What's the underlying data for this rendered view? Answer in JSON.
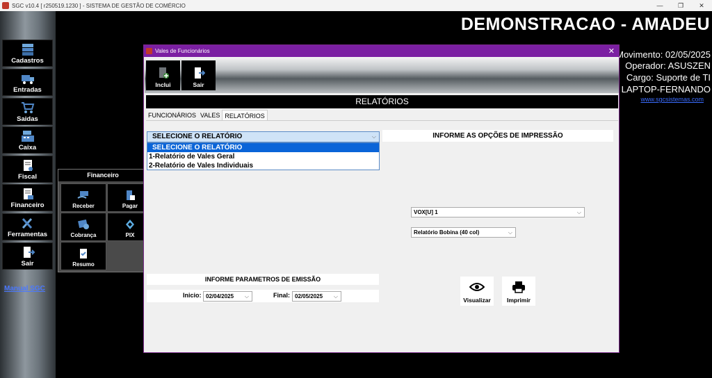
{
  "window": {
    "title": "SGC v10.4 [ r250519.1230 ] - SISTEMA DE GESTÃO DE COMÉRCIO",
    "controls": [
      "—",
      "❐",
      "✕"
    ]
  },
  "sidebar": {
    "items": [
      {
        "label": "Cadastros",
        "icon": "cabinet-icon"
      },
      {
        "label": "Entradas",
        "icon": "truck-icon"
      },
      {
        "label": "Saidas",
        "icon": "cart-icon"
      },
      {
        "label": "Caixa",
        "icon": "register-icon"
      },
      {
        "label": "Fiscal",
        "icon": "fiscal-doc-icon"
      },
      {
        "label": "Financeiro",
        "icon": "finance-doc-icon"
      },
      {
        "label": "Ferramentas",
        "icon": "tools-icon"
      },
      {
        "label": "Sair",
        "icon": "exit-door-icon"
      }
    ],
    "manual_link": "Manual SGC"
  },
  "header": {
    "company": "DEMONSTRACAO - AMADEU",
    "movimento": "Movimento: 02/05/2025",
    "operador": "Operador: ASUSZEN",
    "cargo": "Cargo: Suporte de TI",
    "machine": "LAPTOP-FERNANDO",
    "site": "www.sgcsistemas.com"
  },
  "financeiro_panel": {
    "title": "Financeiro",
    "buttons": [
      {
        "label": "Receber",
        "icon": "receive-money-icon"
      },
      {
        "label": "Pagar",
        "icon": "pay-icon"
      },
      {
        "label": "Cobrança",
        "icon": "billing-icon"
      },
      {
        "label": "PIX",
        "icon": "pix-icon"
      },
      {
        "label": "Resumo",
        "icon": "summary-icon"
      }
    ]
  },
  "modal": {
    "title": "Vales de Funcionários",
    "toolbar": {
      "incluir": "Inclui",
      "sair": "Sair"
    },
    "header": "RELATÓRIOS",
    "tabs": [
      "FUNCIONÁRIOS",
      "VALES",
      "RELATÓRIOS"
    ],
    "active_tab": "RELATÓRIOS",
    "report_select": {
      "value": "SELECIONE O RELATÓRIO",
      "options": [
        "SELECIONE O RELATÓRIO",
        "1-Relatório de Vales Geral",
        "2-Relatório de Vales Individuais"
      ]
    },
    "print_options_label": "INFORME AS OPÇÕES DE IMPRESSÃO",
    "printer_select": "VOX[U] 1",
    "format_select": "Relatório Bobina (40 col)",
    "emission_label": "INFORME PARAMETROS DE EMISSÃO",
    "inicio_label": "Inicio:",
    "inicio_value": "02/04/2025",
    "final_label": "Final:",
    "final_value": "02/05/2025",
    "visualizar": "Visualizar",
    "imprimir": "Imprimir"
  },
  "colors": {
    "modal_titlebar": "#7b1fa2",
    "dropdown_selected": "#0a64d8",
    "link": "#3a6cff"
  }
}
